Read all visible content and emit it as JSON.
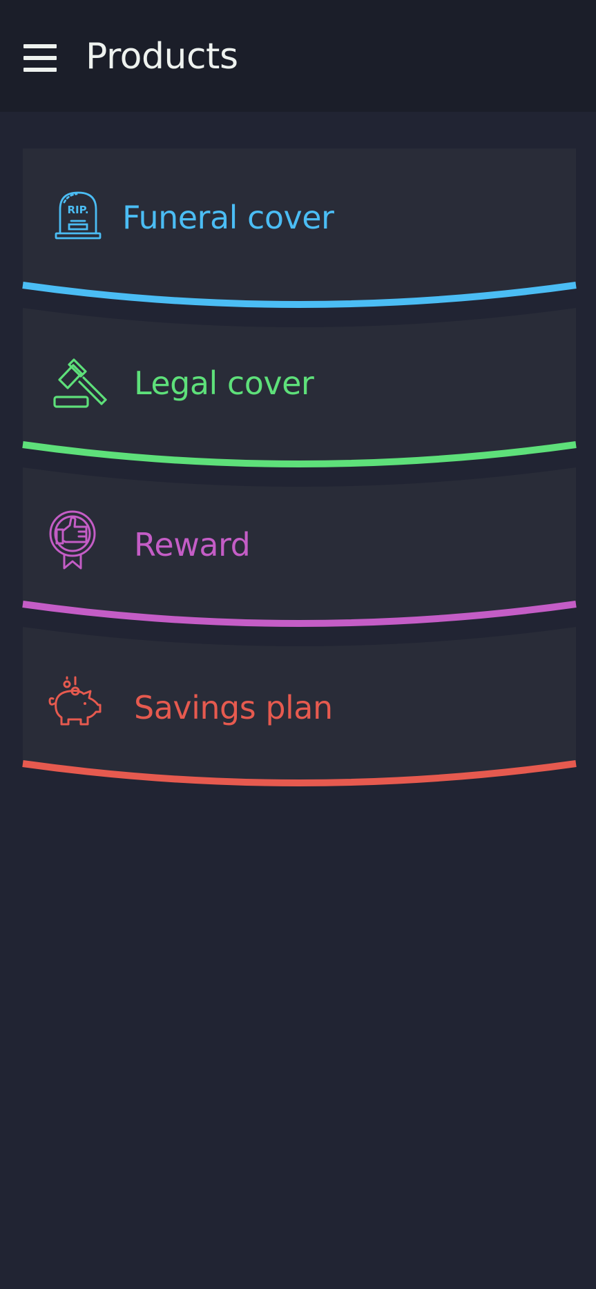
{
  "header": {
    "title": "Products",
    "menu_icon": "hamburger-menu-icon"
  },
  "products": [
    {
      "label": "Funeral cover",
      "icon": "tombstone-icon",
      "icon_text": "RIP.",
      "color": "#4bbdf4"
    },
    {
      "label": "Legal cover",
      "icon": "gavel-icon",
      "color": "#5ee07a"
    },
    {
      "label": "Reward",
      "icon": "thumbs-up-medal-icon",
      "color": "#c45dc6"
    },
    {
      "label": "Savings plan",
      "icon": "piggy-bank-icon",
      "color": "#e65a4f"
    }
  ],
  "colors": {
    "background": "#212433",
    "appbar": "#1b1e29",
    "card": "#292c38",
    "title": "#eef2ef"
  }
}
